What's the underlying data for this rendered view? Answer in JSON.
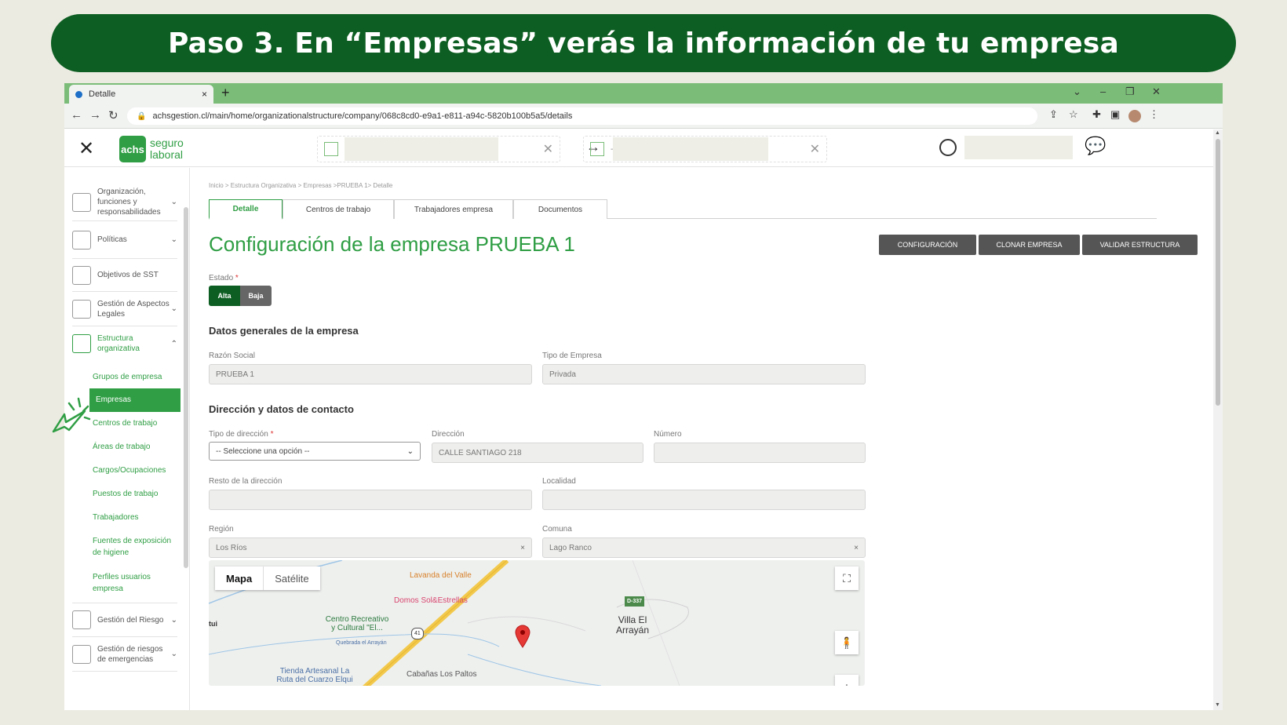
{
  "banner": {
    "title": "Paso 3. En “Empresas” verás la información de tu empresa"
  },
  "browser": {
    "tab_title": "Detalle",
    "tab_close": "×",
    "new_tab": "+",
    "url": "achsgestion.cl/main/home/organizationalstructure/company/068c8cd0-e9a1-e811-a94c-5820b100b5a5/details"
  },
  "header": {
    "logo_badge": "achs",
    "logo_line1": "seguro",
    "logo_line2": "laboral",
    "close": "✕",
    "swap": "↔",
    "dash": "- ",
    "clear1": "✕",
    "clear2": "✕"
  },
  "sidebar": {
    "items": [
      {
        "label": "Organización, funciones y responsabilidades"
      },
      {
        "label": "Políticas"
      },
      {
        "label": "Objetivos de SST"
      },
      {
        "label": "Gestión de Aspectos Legales"
      },
      {
        "label": "Estructura organizativa"
      }
    ],
    "subitems": [
      "Grupos de empresa",
      "Empresas",
      "Centros de trabajo",
      "Áreas de trabajo",
      "Cargos/Ocupaciones",
      "Puestos de trabajo",
      "Trabajadores",
      "Fuentes de exposición de higiene",
      "Perfiles usuarios empresa"
    ],
    "bottom_items": [
      {
        "label": "Gestión del Riesgo"
      },
      {
        "label": "Gestión de riesgos de emergencias"
      }
    ]
  },
  "main": {
    "breadcrumb": "Inicio > Estructura Organizativa > Empresas >PRUEBA 1> Detalle",
    "tabs": [
      "Detalle",
      "Centros de trabajo",
      "Trabajadores empresa",
      "Documentos"
    ],
    "title": "Configuración de la empresa PRUEBA 1",
    "actions": [
      "CONFIGURACIÓN",
      "CLONAR EMPRESA",
      "VALIDAR ESTRUCTURA"
    ],
    "estado_label": "Estado",
    "required_mark": "*",
    "estado_options": [
      "Alta",
      "Baja"
    ],
    "section_general": "Datos generales de la empresa",
    "razon_label": "Razón Social",
    "razon_value": "PRUEBA 1",
    "tipo_empresa_label": "Tipo de Empresa",
    "tipo_empresa_value": "Privada",
    "section_contact": "Dirección y datos de contacto",
    "tipo_dir_label": "Tipo de dirección",
    "tipo_dir_value": "-- Seleccione una opción --",
    "direccion_label": "Dirección",
    "direccion_value": "CALLE SANTIAGO 218",
    "numero_label": "Número",
    "numero_value": "",
    "resto_label": "Resto de la dirección",
    "resto_value": "",
    "localidad_label": "Localidad",
    "localidad_value": "",
    "region_label": "Región",
    "region_value": "Los Ríos",
    "comuna_label": "Comuna",
    "comuna_value": "Lago Ranco",
    "clear": "×"
  },
  "map": {
    "mode_map": "Mapa",
    "mode_sat": "Satélite",
    "fullscreen": "⛶",
    "plus": "+",
    "road_label": "41",
    "route_label": "D-337",
    "pois": [
      {
        "name": "Lavanda del Valle"
      },
      {
        "name": "Domos Sol&Estrellas"
      },
      {
        "name": "Centro Recreativo y Cultural \"El..."
      },
      {
        "name": "Villa El Arrayán"
      },
      {
        "name": "Quebrada el Arrayán"
      },
      {
        "name": "Tienda Artesanal La Ruta del Cuarzo Elqui"
      },
      {
        "name": "Cabañas Los Paltos"
      },
      {
        "name": "tui"
      }
    ]
  },
  "colors": {
    "brand_green": "#2f9e44",
    "banner_green": "#0d5e22",
    "chrome_green": "#7bbd78"
  }
}
